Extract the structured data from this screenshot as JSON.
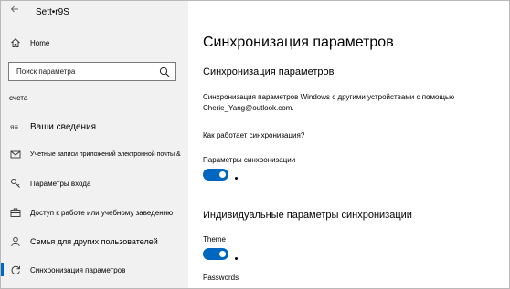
{
  "window": {
    "title": "Sett•r9S"
  },
  "sidebar": {
    "home_label": "Home",
    "search_placeholder": "Поиск параметра",
    "section_label": "счета",
    "items": [
      {
        "label": "Ваши сведения",
        "icon": "person-card-icon"
      },
      {
        "label": "Учетные записи приложений электронной почты &",
        "icon": "mail-icon"
      },
      {
        "label": "Параметры входа",
        "icon": "key-icon"
      },
      {
        "label": "Доступ к работе или учебному заведению",
        "icon": "briefcase-icon"
      },
      {
        "label": "Семья для других пользователей",
        "icon": "person-icon"
      },
      {
        "label": "Синхронизация параметров",
        "icon": "sync-icon",
        "active": true
      }
    ]
  },
  "main": {
    "title": "Синхронизация параметров",
    "section_title": "Синхронизация параметров",
    "description": "Синхронизация параметров Windows с другими устройствами с помощью Cherie_Yang@outlook.com.",
    "how_link": "Как работает синхронизация?",
    "sync_settings_label": "Параметры синхронизации",
    "sync_toggle_on": true,
    "individual_title": "Индивидуальные параметры синхронизации",
    "theme_label": "Theme",
    "theme_toggle_on": true,
    "passwords_label": "Passwords"
  },
  "colors": {
    "accent": "#0067c0",
    "sidebar_bg": "#f1f1f1"
  }
}
